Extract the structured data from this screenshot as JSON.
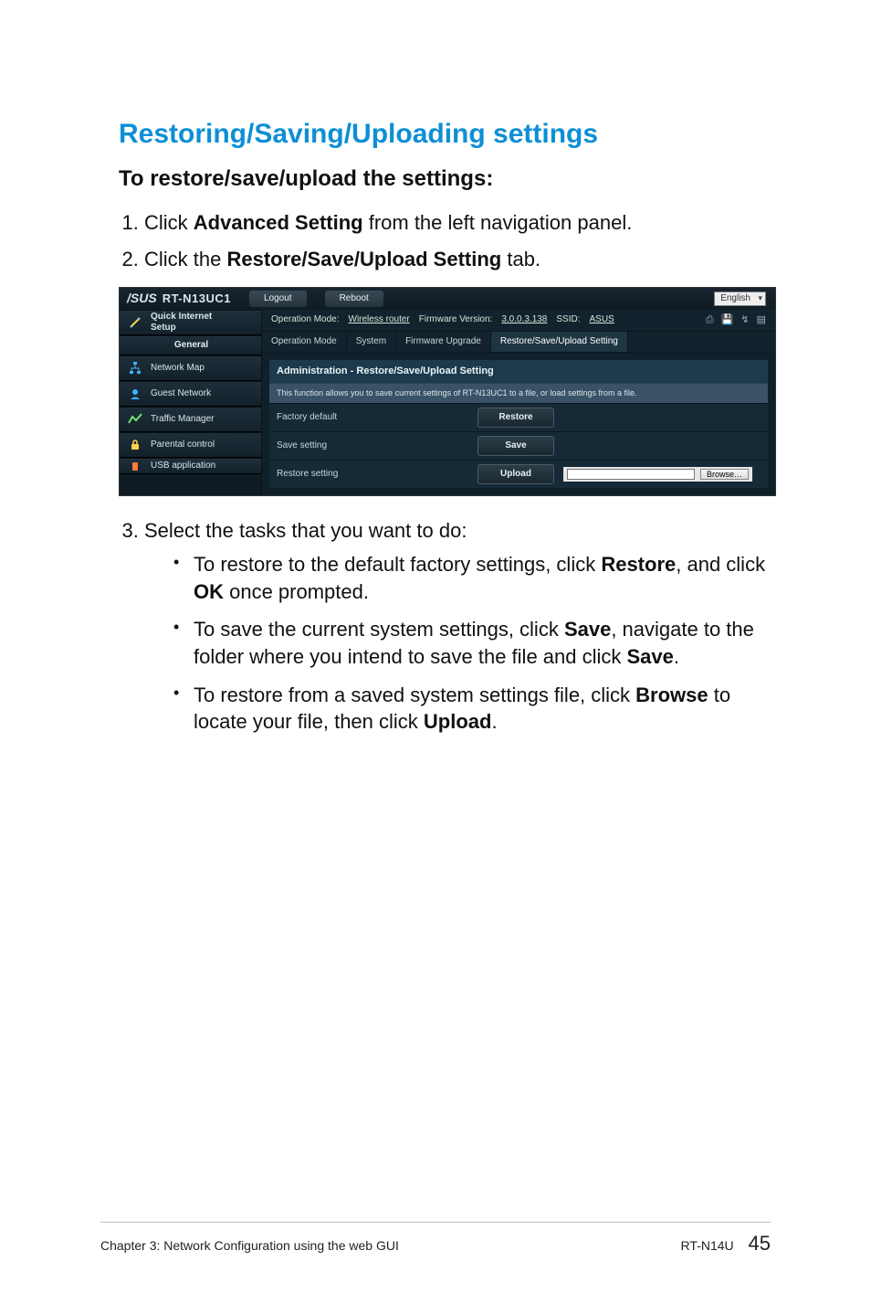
{
  "doc": {
    "section_title": "Restoring/Saving/Uploading settings",
    "subheading": "To restore/save/upload the settings:",
    "steps": {
      "s1_a": "Click ",
      "s1_b": "Advanced Setting",
      "s1_c": " from the left navigation panel.",
      "s2_a": "Click the ",
      "s2_b": "Restore/Save/Upload Setting",
      "s2_c": " tab.",
      "s3": "Select the tasks that you want to do:"
    },
    "bullets": {
      "b1_a": "To restore to the default factory settings, click ",
      "b1_b": "Restore",
      "b1_c": ", and click ",
      "b1_d": "OK",
      "b1_e": " once prompted.",
      "b2_a": "To save the current system settings, click ",
      "b2_b": "Save",
      "b2_c": ", navigate to the folder where you intend to save the file and click ",
      "b2_d": "Save",
      "b2_e": ".",
      "b3_a": "To restore from a saved system settings file, click ",
      "b3_b": "Browse",
      "b3_c": " to locate your file, then click ",
      "b3_d": "Upload",
      "b3_e": "."
    },
    "footer_chapter": "Chapter 3: Network Configuration using the web GUI",
    "footer_model": "RT-N14U",
    "footer_page": "45"
  },
  "router": {
    "model": "RT-N13UC1",
    "brand": "/SUS",
    "logout": "Logout",
    "reboot": "Reboot",
    "language": "English",
    "info": {
      "op_mode_label": "Operation Mode:",
      "op_mode_value": "Wireless router",
      "fw_label": "Firmware Version:",
      "fw_value": "3.0.0.3.138",
      "ssid_label": "SSID:",
      "ssid_value": "ASUS"
    },
    "tabs": [
      "Operation Mode",
      "System",
      "Firmware Upgrade",
      "Restore/Save/Upload Setting"
    ],
    "sidebar": {
      "qis_line1": "Quick Internet",
      "qis_line2": "Setup",
      "general": "General",
      "items": [
        "Network Map",
        "Guest Network",
        "Traffic Manager",
        "Parental control",
        "USB application"
      ]
    },
    "panel": {
      "head": "Administration - Restore/Save/Upload Setting",
      "sub": "This function allows you to save current settings of RT-N13UC1 to a file, or load settings from a file.",
      "rows": [
        {
          "label": "Factory default",
          "button": "Restore"
        },
        {
          "label": "Save setting",
          "button": "Save"
        },
        {
          "label": "Restore setting",
          "button": "Upload"
        }
      ],
      "browse": "Browse…"
    }
  }
}
